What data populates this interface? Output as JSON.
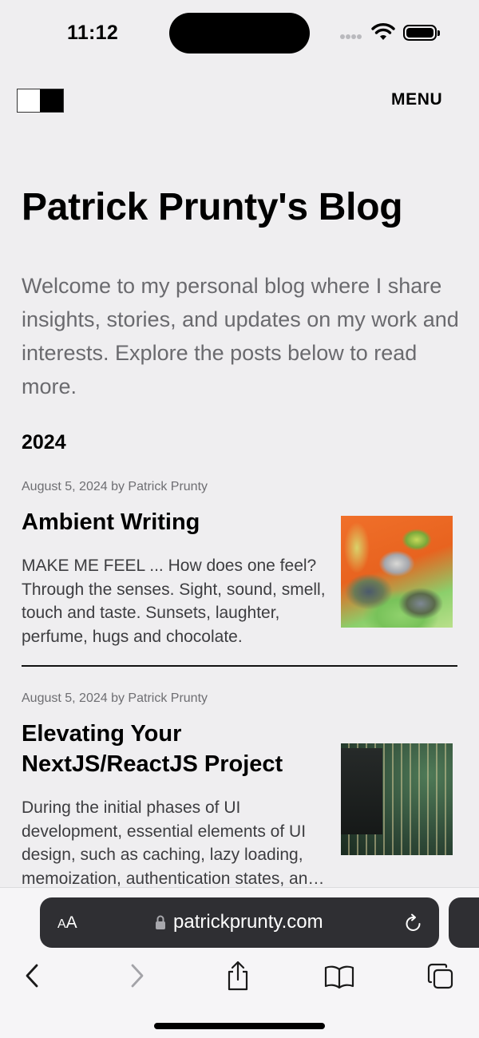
{
  "status_bar": {
    "time": "11:12",
    "icons": [
      "cellular-signal-icon",
      "wifi-icon",
      "battery-icon"
    ]
  },
  "header": {
    "theme_toggle_icon": "light-dark-toggle-icon",
    "menu_label": "MENU"
  },
  "main": {
    "title": "Patrick Prunty's Blog",
    "intro": "Welcome to my personal blog where I share insights, stories, and updates on my work and interests. Explore the posts below to read more.",
    "year": "2024",
    "posts": [
      {
        "meta": "August 5, 2024 by Patrick Prunty",
        "title": "Ambient Writing",
        "excerpt": "MAKE ME FEEL ... How does one feel? Through the senses. Sight, sound, smell, touch and taste. Sunsets, laughter, perfume, hugs and chocolate.",
        "thumbnail": "abstract-art-image"
      },
      {
        "meta": "August 5, 2024 by Patrick Prunty",
        "title": "Elevating Your NextJS/ReactJS Project",
        "excerpt": "During the initial phases of UI development, essential elements of UI design, such as caching, lazy loading, memoization, authentication states, and more.",
        "thumbnail": "circuit-board-image"
      }
    ]
  },
  "browser": {
    "text_size_label_small": "A",
    "text_size_label_large": "A",
    "url": "patrickprunty.com",
    "toolbar_icons": [
      "back-icon",
      "forward-icon",
      "share-icon",
      "bookmarks-icon",
      "tabs-icon"
    ]
  },
  "colors": {
    "background": "#efeef0",
    "text_primary": "#000000",
    "text_secondary": "#6a6a6e",
    "address_bar": "#2f2f33"
  }
}
